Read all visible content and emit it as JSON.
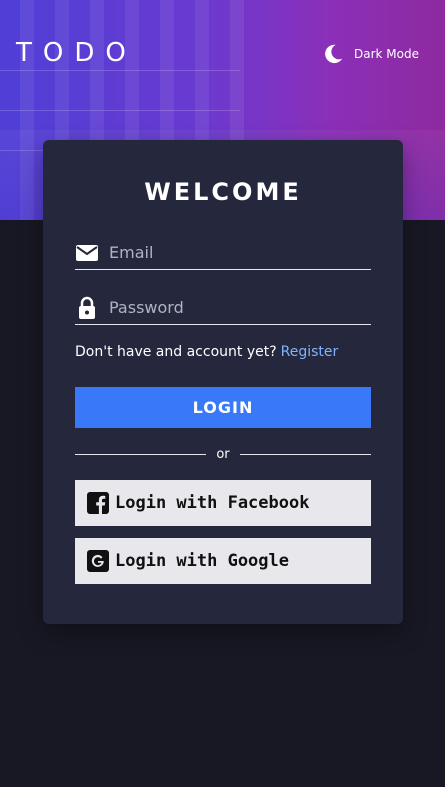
{
  "header": {
    "logo": "TODO",
    "theme_toggle_label": "Dark Mode",
    "theme_icon": "moon-icon"
  },
  "login_card": {
    "title": "WELCOME",
    "email": {
      "placeholder": "Email",
      "value": "",
      "icon": "envelope-icon"
    },
    "password": {
      "placeholder": "Password",
      "value": "",
      "icon": "lock-icon"
    },
    "register_prompt": "Don't have and account yet?",
    "register_link": "Register",
    "login_button": "LOGIN",
    "divider_text": "or",
    "facebook_button": {
      "label": "Login with Facebook",
      "icon": "facebook-icon"
    },
    "google_button": {
      "label": "Login with Google",
      "icon": "google-icon"
    }
  },
  "colors": {
    "background": "#181824",
    "card": "#25273c",
    "accent": "#3a78fa",
    "link": "#7fb3ff",
    "social_button_bg": "#e8e7ec"
  }
}
